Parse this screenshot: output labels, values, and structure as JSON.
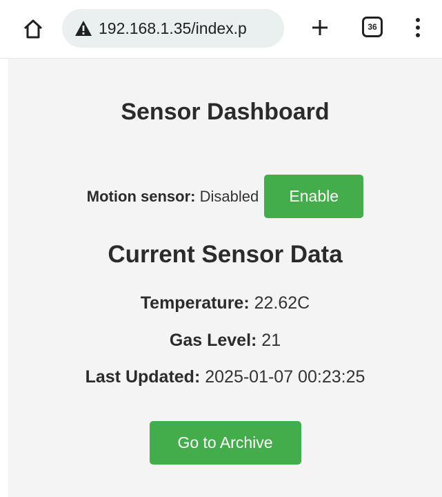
{
  "browser": {
    "url": "192.168.1.35/index.p",
    "tab_count": "36",
    "icons": {
      "home": "home-icon",
      "warning": "warning-icon",
      "new_tab": "plus-icon",
      "tabs": "tab-switcher-icon",
      "menu": "more-vert-icon"
    }
  },
  "page": {
    "title": "Sensor Dashboard",
    "motion": {
      "label": "Motion sensor:",
      "status": "Disabled",
      "button_label": "Enable"
    },
    "section_title": "Current Sensor Data",
    "readings": {
      "temperature_label": "Temperature:",
      "temperature_value": "22.62C",
      "gas_label": "Gas Level:",
      "gas_value": "21",
      "updated_label": "Last Updated:",
      "updated_value": "2025-01-07 00:23:25"
    },
    "archive_button_label": "Go to Archive"
  },
  "colors": {
    "accent_button": "#44ad4b",
    "page_background": "#f4f4f4",
    "url_pill": "#e9f0ef"
  }
}
